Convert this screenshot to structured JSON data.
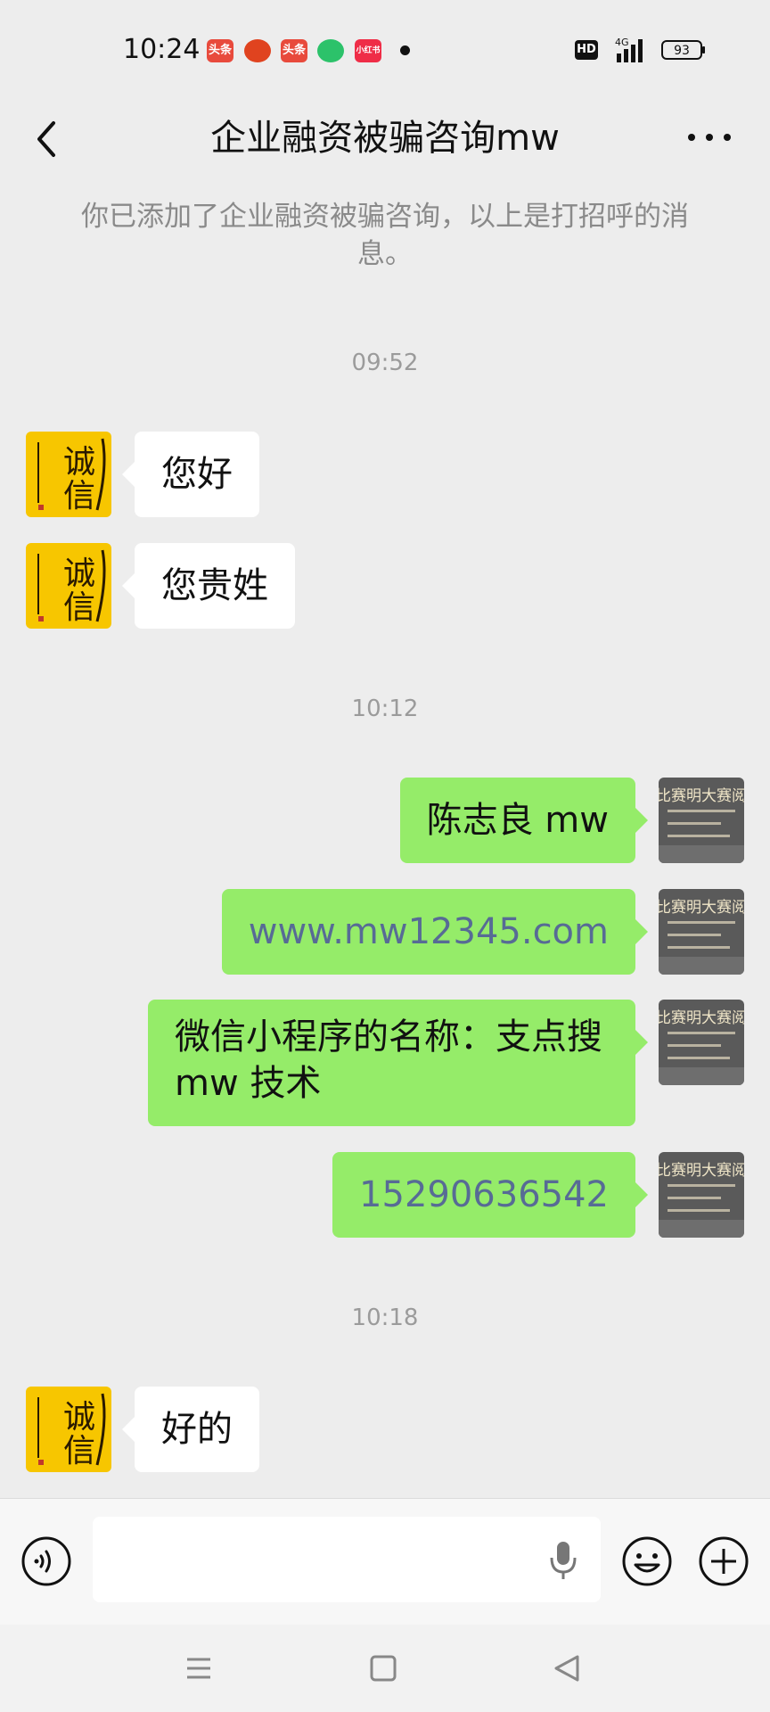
{
  "status_bar": {
    "time": "10:24",
    "notification_icons": [
      {
        "name": "toutiao-icon",
        "label": "头条",
        "color": "#e84a3c"
      },
      {
        "name": "pinduoduo-icon",
        "label": "",
        "color": "#e0431f"
      },
      {
        "name": "toutiao-icon-2",
        "label": "头条",
        "color": "#e84a3c"
      },
      {
        "name": "green-app-icon",
        "label": "",
        "color": "#2cc26a"
      },
      {
        "name": "xiaohongshu-icon",
        "label": "小红书",
        "color": "#ef2d47"
      }
    ],
    "hd_label": "HD",
    "network_label": "4G",
    "battery_level": "93"
  },
  "header": {
    "title": "企业融资被骗咨询mw"
  },
  "system_notice": "你已添加了企业融资被骗咨询，以上是打招呼的消息。",
  "timestamps": [
    "09:52",
    "10:12",
    "10:18"
  ],
  "messages": [
    {
      "direction": "in",
      "text": "您好"
    },
    {
      "direction": "in",
      "text": "您贵姓"
    },
    {
      "direction": "out",
      "text": "陈志良 mw"
    },
    {
      "direction": "out",
      "text": "www.mw12345.com",
      "is_link": true
    },
    {
      "direction": "out",
      "text": "微信小程序的名称：支点搜mw 技术"
    },
    {
      "direction": "out",
      "text": "15290636542",
      "is_link": true
    },
    {
      "direction": "in",
      "text": "好的"
    }
  ],
  "avatars": {
    "contact": {
      "text": "诚信",
      "bg_color": "#f7c600"
    },
    "self": {
      "text": "比赛明大赛阅",
      "bg_color": "#5a5a5a"
    }
  },
  "input_bar": {
    "placeholder": "",
    "value": ""
  },
  "colors": {
    "background": "#ededed",
    "sent_bubble": "#95ec69",
    "received_bubble": "#ffffff",
    "link": "#576b95"
  }
}
